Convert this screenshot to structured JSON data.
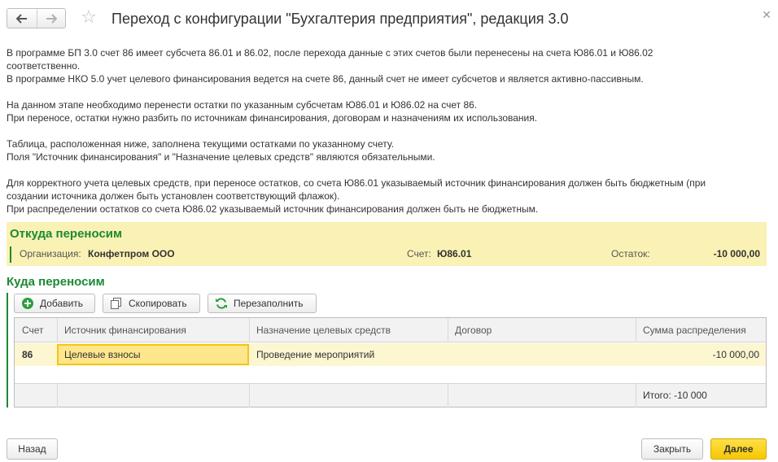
{
  "window": {
    "title": "Переход с конфигурации \"Бухгалтерия предприятия\", редакция 3.0",
    "icons": {
      "back": "arrow-left-icon",
      "forward": "arrow-right-icon",
      "favorite": "star-icon",
      "close": "close-icon"
    }
  },
  "info": {
    "paragraphs": [
      [
        "В программе БП 3.0 счет 86 имеет субсчета 86.01 и 86.02, после перехода данные с этих счетов были перенесены на счета Ю86.01 и Ю86.02",
        "соответственно.",
        "В программе НКО 5.0 учет целевого финансирования ведется на счете 86, данный счет не имеет субсчетов и является активно-пассивным."
      ],
      [
        "На данном этапе необходимо перенести остатки по указанным субсчетам Ю86.01 и Ю86.02 на счет 86.",
        "При переносе, остатки нужно разбить по источникам финансирования, договорам и назначениям их использования."
      ],
      [
        "Таблица, расположенная ниже, заполнена текущими остатками по указанному счету.",
        "Поля \"Источник финансирования\" и \"Назначение целевых средств\" являются обязательными."
      ],
      [
        "Для корректного учета целевых средств, при переносе остатков, со счета Ю86.01 указываемый источник финансирования должен быть бюджетным (при",
        "создании источника должен быть установлен соответствующий флажок).",
        "При распределении остатков со счета Ю86.02 указываемый источник финансирования должен быть не бюджетным."
      ]
    ]
  },
  "from_section": {
    "title": "Откуда переносим",
    "org_label": "Организация:",
    "org_value": "Конфетпром ООО",
    "account_label": "Счет:",
    "account_value": "Ю86.01",
    "balance_label": "Остаток:",
    "balance_value": "-10 000,00"
  },
  "to_section": {
    "title": "Куда переносим",
    "toolbar": {
      "add_label": "Добавить",
      "copy_label": "Скопировать",
      "refill_label": "Перезаполнить"
    },
    "table": {
      "columns": [
        "Счет",
        "Источник финансирования",
        "Назначение целевых средств",
        "Договор",
        "Сумма распределения"
      ],
      "rows": [
        {
          "account": "86",
          "source": "Целевые взносы",
          "purpose": "Проведение мероприятий",
          "contract": "",
          "amount": "-10 000,00"
        }
      ],
      "total": "Итого: -10 000"
    }
  },
  "footer": {
    "back_label": "Назад",
    "close_label": "Закрыть",
    "next_label": "Далее"
  },
  "colors": {
    "accent_green": "#1a8a33",
    "section_bg": "#faf2b4",
    "selected_cell": "#fde68b",
    "primary_button": "#f6c800"
  }
}
